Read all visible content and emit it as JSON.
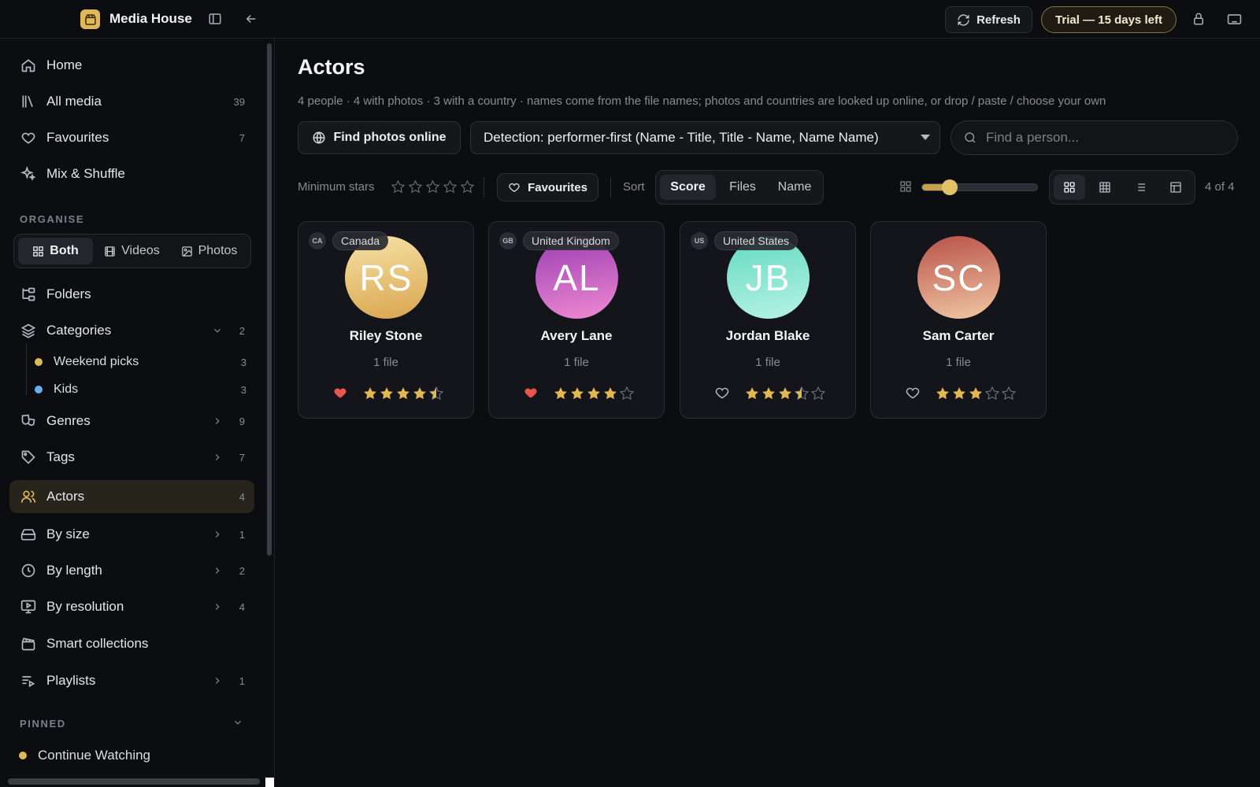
{
  "app": {
    "title": "Media House",
    "refresh_label": "Refresh",
    "trial_label": "Trial — 15 days left"
  },
  "sidebar": {
    "nav": [
      {
        "label": "Home",
        "count": "",
        "icon": "home-icon"
      },
      {
        "label": "All media",
        "count": "39",
        "icon": "library-icon"
      },
      {
        "label": "Favourites",
        "count": "7",
        "icon": "heart-icon"
      },
      {
        "label": "Mix & Shuffle",
        "count": "",
        "icon": "sparkles-icon"
      }
    ],
    "organise_label": "ORGANISE",
    "media_filter": [
      {
        "label": "Both",
        "icon": "grid-icon",
        "active": true
      },
      {
        "label": "Videos",
        "icon": "film-icon",
        "active": false
      },
      {
        "label": "Photos",
        "icon": "image-icon",
        "active": false
      }
    ],
    "folders_label": "Folders",
    "categories": {
      "label": "Categories",
      "count": "2",
      "items": [
        {
          "label": "Weekend picks",
          "count": "3",
          "color": "#e0b85a"
        },
        {
          "label": "Kids",
          "count": "3",
          "color": "#6aaef0"
        }
      ]
    },
    "groups": [
      {
        "label": "Genres",
        "count": "9",
        "icon": "masks-icon"
      },
      {
        "label": "Tags",
        "count": "7",
        "icon": "tag-icon"
      },
      {
        "label": "Actors",
        "count": "4",
        "icon": "users-icon",
        "active": true
      },
      {
        "label": "By size",
        "count": "1",
        "icon": "hard-drive-icon"
      },
      {
        "label": "By length",
        "count": "2",
        "icon": "clock-icon"
      },
      {
        "label": "By resolution",
        "count": "4",
        "icon": "monitor-play-icon"
      },
      {
        "label": "Smart collections",
        "count": "",
        "icon": "clapperboard-icon"
      },
      {
        "label": "Playlists",
        "count": "1",
        "icon": "playlist-icon"
      }
    ],
    "pinned_label": "PINNED",
    "pinned": [
      {
        "label": "Continue Watching",
        "color": "#e0b85a"
      }
    ]
  },
  "main": {
    "title": "Actors",
    "subtitle": "4 people · 4 with photos · 3 with a country · names come from the file names; photos and countries are looked up online, or drop / paste / choose your own",
    "find_photos_label": "Find photos online",
    "detection_label": "Detection: performer-first (Name - Title, Title - Name, Name Name)",
    "search_placeholder": "Find a person...",
    "min_stars_label": "Minimum stars",
    "min_stars_value": 0,
    "favourites_label": "Favourites",
    "sort_label": "Sort",
    "sort_options": [
      {
        "label": "Score",
        "active": true
      },
      {
        "label": "Files",
        "active": false
      },
      {
        "label": "Name",
        "active": false
      }
    ],
    "card_size_fraction": 0.24,
    "view_modes": [
      {
        "icon": "grid-large-icon",
        "active": true
      },
      {
        "icon": "grid-small-icon",
        "active": false
      },
      {
        "icon": "list-icon",
        "active": false
      },
      {
        "icon": "table-icon",
        "active": false
      }
    ],
    "count_label": "4 of 4"
  },
  "people": [
    {
      "initials": "RS",
      "name": "Riley Stone",
      "files": "1 file",
      "country_code": "CA",
      "country": "Canada",
      "favourite": true,
      "rating": 4.5,
      "gradient": [
        "#f6e2a6",
        "#d9a54f"
      ]
    },
    {
      "initials": "AL",
      "name": "Avery Lane",
      "files": "1 file",
      "country_code": "GB",
      "country": "United Kingdom",
      "favourite": true,
      "rating": 4,
      "gradient": [
        "#9a3db3",
        "#f08ad2"
      ]
    },
    {
      "initials": "JB",
      "name": "Jordan Blake",
      "files": "1 file",
      "country_code": "US",
      "country": "United States",
      "favourite": false,
      "rating": 3.5,
      "gradient": [
        "#63d9c1",
        "#b6f3e4"
      ]
    },
    {
      "initials": "SC",
      "name": "Sam Carter",
      "files": "1 file",
      "country_code": "",
      "country": "",
      "favourite": false,
      "rating": 3,
      "gradient": [
        "#b9524a",
        "#f0c7a3"
      ]
    }
  ],
  "colors": {
    "accent": "#e0b85a",
    "heart": "#e8564c",
    "star": "#e3b64e",
    "star_empty": "#6b6f78"
  }
}
